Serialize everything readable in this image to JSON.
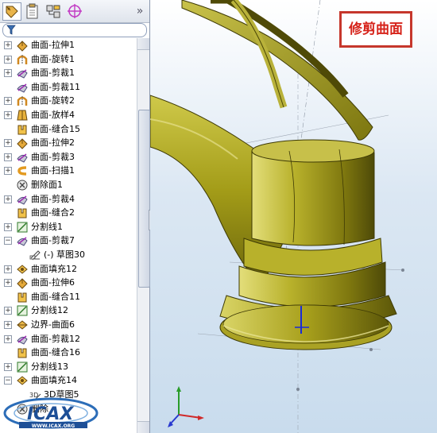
{
  "toolbar": {
    "tabs": [
      {
        "icon": "feature-manager-icon"
      },
      {
        "icon": "property-manager-icon"
      },
      {
        "icon": "configuration-manager-icon"
      },
      {
        "icon": "dimxpert-manager-icon"
      }
    ],
    "more_label": "»"
  },
  "filter": {
    "icon": "filter-icon"
  },
  "tree": {
    "items": [
      {
        "label": "曲面-拉伸1",
        "icon": "extrude-surface-icon",
        "expand": "+"
      },
      {
        "label": "曲面-旋转1",
        "icon": "revolve-surface-icon",
        "expand": "+"
      },
      {
        "label": "曲面-剪裁1",
        "icon": "trim-surface-icon",
        "expand": "+"
      },
      {
        "label": "曲面-剪裁11",
        "icon": "trim-surface-icon",
        "expand": ""
      },
      {
        "label": "曲面-旋转2",
        "icon": "revolve-surface-icon",
        "expand": "+"
      },
      {
        "label": "曲面-放样4",
        "icon": "loft-surface-icon",
        "expand": "+"
      },
      {
        "label": "曲面-缝合15",
        "icon": "knit-surface-icon",
        "expand": ""
      },
      {
        "label": "曲面-拉伸2",
        "icon": "extrude-surface-icon",
        "expand": "+"
      },
      {
        "label": "曲面-剪裁3",
        "icon": "trim-surface-icon",
        "expand": "+"
      },
      {
        "label": "曲面-扫描1",
        "icon": "sweep-surface-icon",
        "expand": "+"
      },
      {
        "label": "删除面1",
        "icon": "delete-face-icon",
        "expand": ""
      },
      {
        "label": "曲面-剪裁4",
        "icon": "trim-surface-icon",
        "expand": "+"
      },
      {
        "label": "曲面-缝合2",
        "icon": "knit-surface-icon",
        "expand": ""
      },
      {
        "label": "分割线1",
        "icon": "split-line-icon",
        "expand": "+"
      },
      {
        "label": "曲面-剪裁7",
        "icon": "trim-surface-icon",
        "expand": "−"
      },
      {
        "label": "(-) 草图30",
        "icon": "sketch-icon",
        "expand": "",
        "child": true
      },
      {
        "label": "曲面填充12",
        "icon": "fill-surface-icon",
        "expand": "+"
      },
      {
        "label": "曲面-拉伸6",
        "icon": "extrude-surface-icon",
        "expand": "+"
      },
      {
        "label": "曲面-缝合11",
        "icon": "knit-surface-icon",
        "expand": ""
      },
      {
        "label": "分割线12",
        "icon": "split-line-icon",
        "expand": "+"
      },
      {
        "label": "边界-曲面6",
        "icon": "boundary-surface-icon",
        "expand": "+"
      },
      {
        "label": "曲面-剪裁12",
        "icon": "trim-surface-icon",
        "expand": "+"
      },
      {
        "label": "曲面-缝合16",
        "icon": "knit-surface-icon",
        "expand": ""
      },
      {
        "label": "分割线13",
        "icon": "split-line-icon",
        "expand": "+"
      },
      {
        "label": "曲面填充14",
        "icon": "fill-surface-icon",
        "expand": "−"
      },
      {
        "label": "3D草图5",
        "icon": "sketch-3d-icon",
        "expand": "",
        "child": true
      },
      {
        "label": "删除",
        "icon": "delete-face-icon",
        "expand": ""
      }
    ]
  },
  "viewport": {
    "callout": "修剪曲面",
    "triad_axes": [
      "x",
      "y",
      "z"
    ],
    "watermark": {
      "brand": "ICAX",
      "url": "WWW.ICAX.ORG"
    }
  },
  "colors": {
    "callout_border": "#c6372c",
    "callout_text": "#d6231a",
    "model_gold": "#a9a21e",
    "model_dark": "#4e4a08",
    "viewport_bg": "#c9dced"
  }
}
